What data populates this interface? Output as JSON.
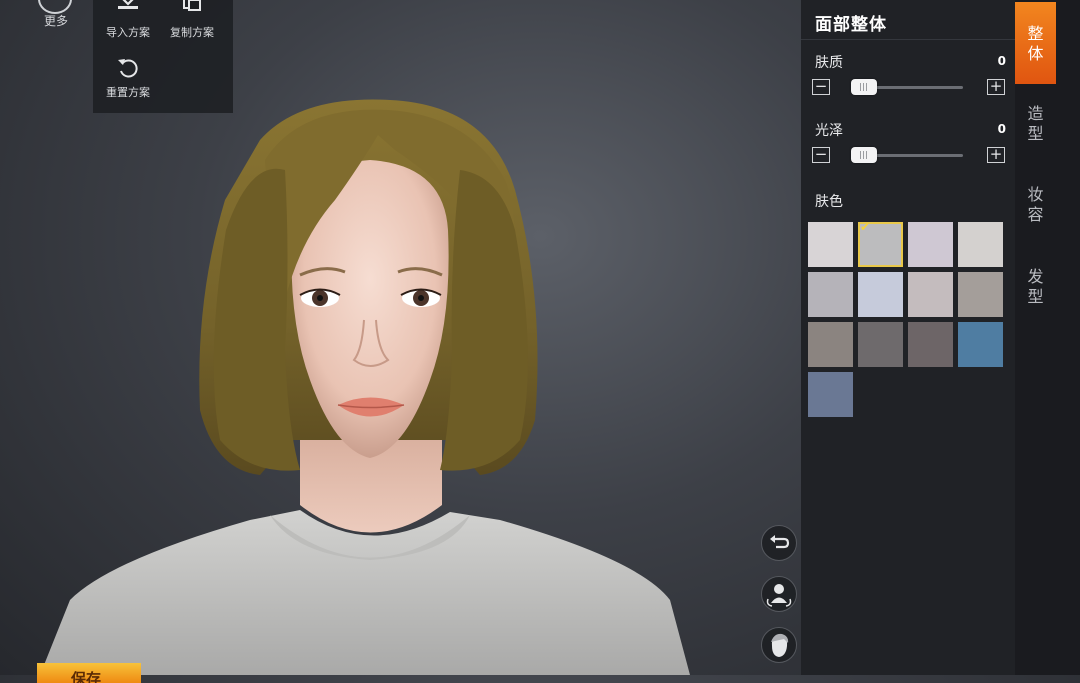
{
  "top_menu": {
    "more_label": "更多",
    "import_label": "导入方案",
    "copy_label": "复制方案",
    "reset_label": "重置方案"
  },
  "panel": {
    "title": "面部整体",
    "sliders": [
      {
        "label": "肤质",
        "value": "0",
        "level": 0.0
      },
      {
        "label": "光泽",
        "value": "0",
        "level": 0.0
      }
    ],
    "minus_label": "−",
    "plus_label": "+",
    "skin_color_label": "肤色",
    "skin_colors": [
      "#d8d4d6",
      "#bcbcbe",
      "#cfc8d3",
      "#d4d1cf",
      "#b5b3b9",
      "#c6cbdb",
      "#c4bcbe",
      "#a49e9a",
      "#8b8480",
      "#6e6a6c",
      "#6d6567",
      "#4f7da2",
      "#6a7894"
    ],
    "selected_swatch_index": 1
  },
  "tabs": [
    {
      "label": "整体",
      "active": true
    },
    {
      "label": "造型",
      "active": false
    },
    {
      "label": "妆容",
      "active": false
    },
    {
      "label": "发型",
      "active": false
    }
  ],
  "side_buttons": [
    "undo-icon",
    "body-pose-icon",
    "head-view-icon"
  ],
  "save_label": "保存",
  "colors": {
    "accent": "#ef7a18",
    "panel_bg": "#202226",
    "hair": "#7d6a2c"
  }
}
